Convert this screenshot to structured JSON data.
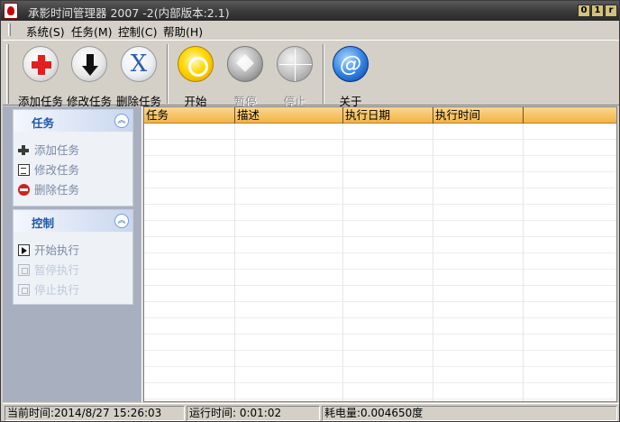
{
  "window": {
    "title": "承影时间管理器 2007 -2(内部版本:2.1)",
    "controls": [
      "0",
      "1",
      "r"
    ]
  },
  "menu": [
    "系统(S)",
    "任务(M)",
    "控制(C)",
    "帮助(H)"
  ],
  "toolbar": {
    "add": "添加任务",
    "edit": "修改任务",
    "delete": "删除任务",
    "start": "开始",
    "pause": "暂停",
    "stop": "停止",
    "about": "关于",
    "delete_glyph": "X",
    "about_glyph": "@"
  },
  "sidebar": {
    "task_group": {
      "title": "任务",
      "items": [
        "添加任务",
        "修改任务",
        "删除任务"
      ]
    },
    "control_group": {
      "title": "控制",
      "items": [
        "开始执行",
        "暂停执行",
        "停止执行"
      ]
    },
    "collapse_glyph": "︽"
  },
  "table": {
    "columns": [
      "任务",
      "描述",
      "执行日期",
      "执行时间"
    ],
    "rows": []
  },
  "status": {
    "current_time": "当前时间:2014/8/27 15:26:03",
    "run_time": "运行时间: 0:01:02",
    "power": "耗电量:0.004650度"
  },
  "colors": {
    "accent": "#2157a8",
    "table_header": "#f3b444",
    "titlebar": "#3c3c3c"
  }
}
